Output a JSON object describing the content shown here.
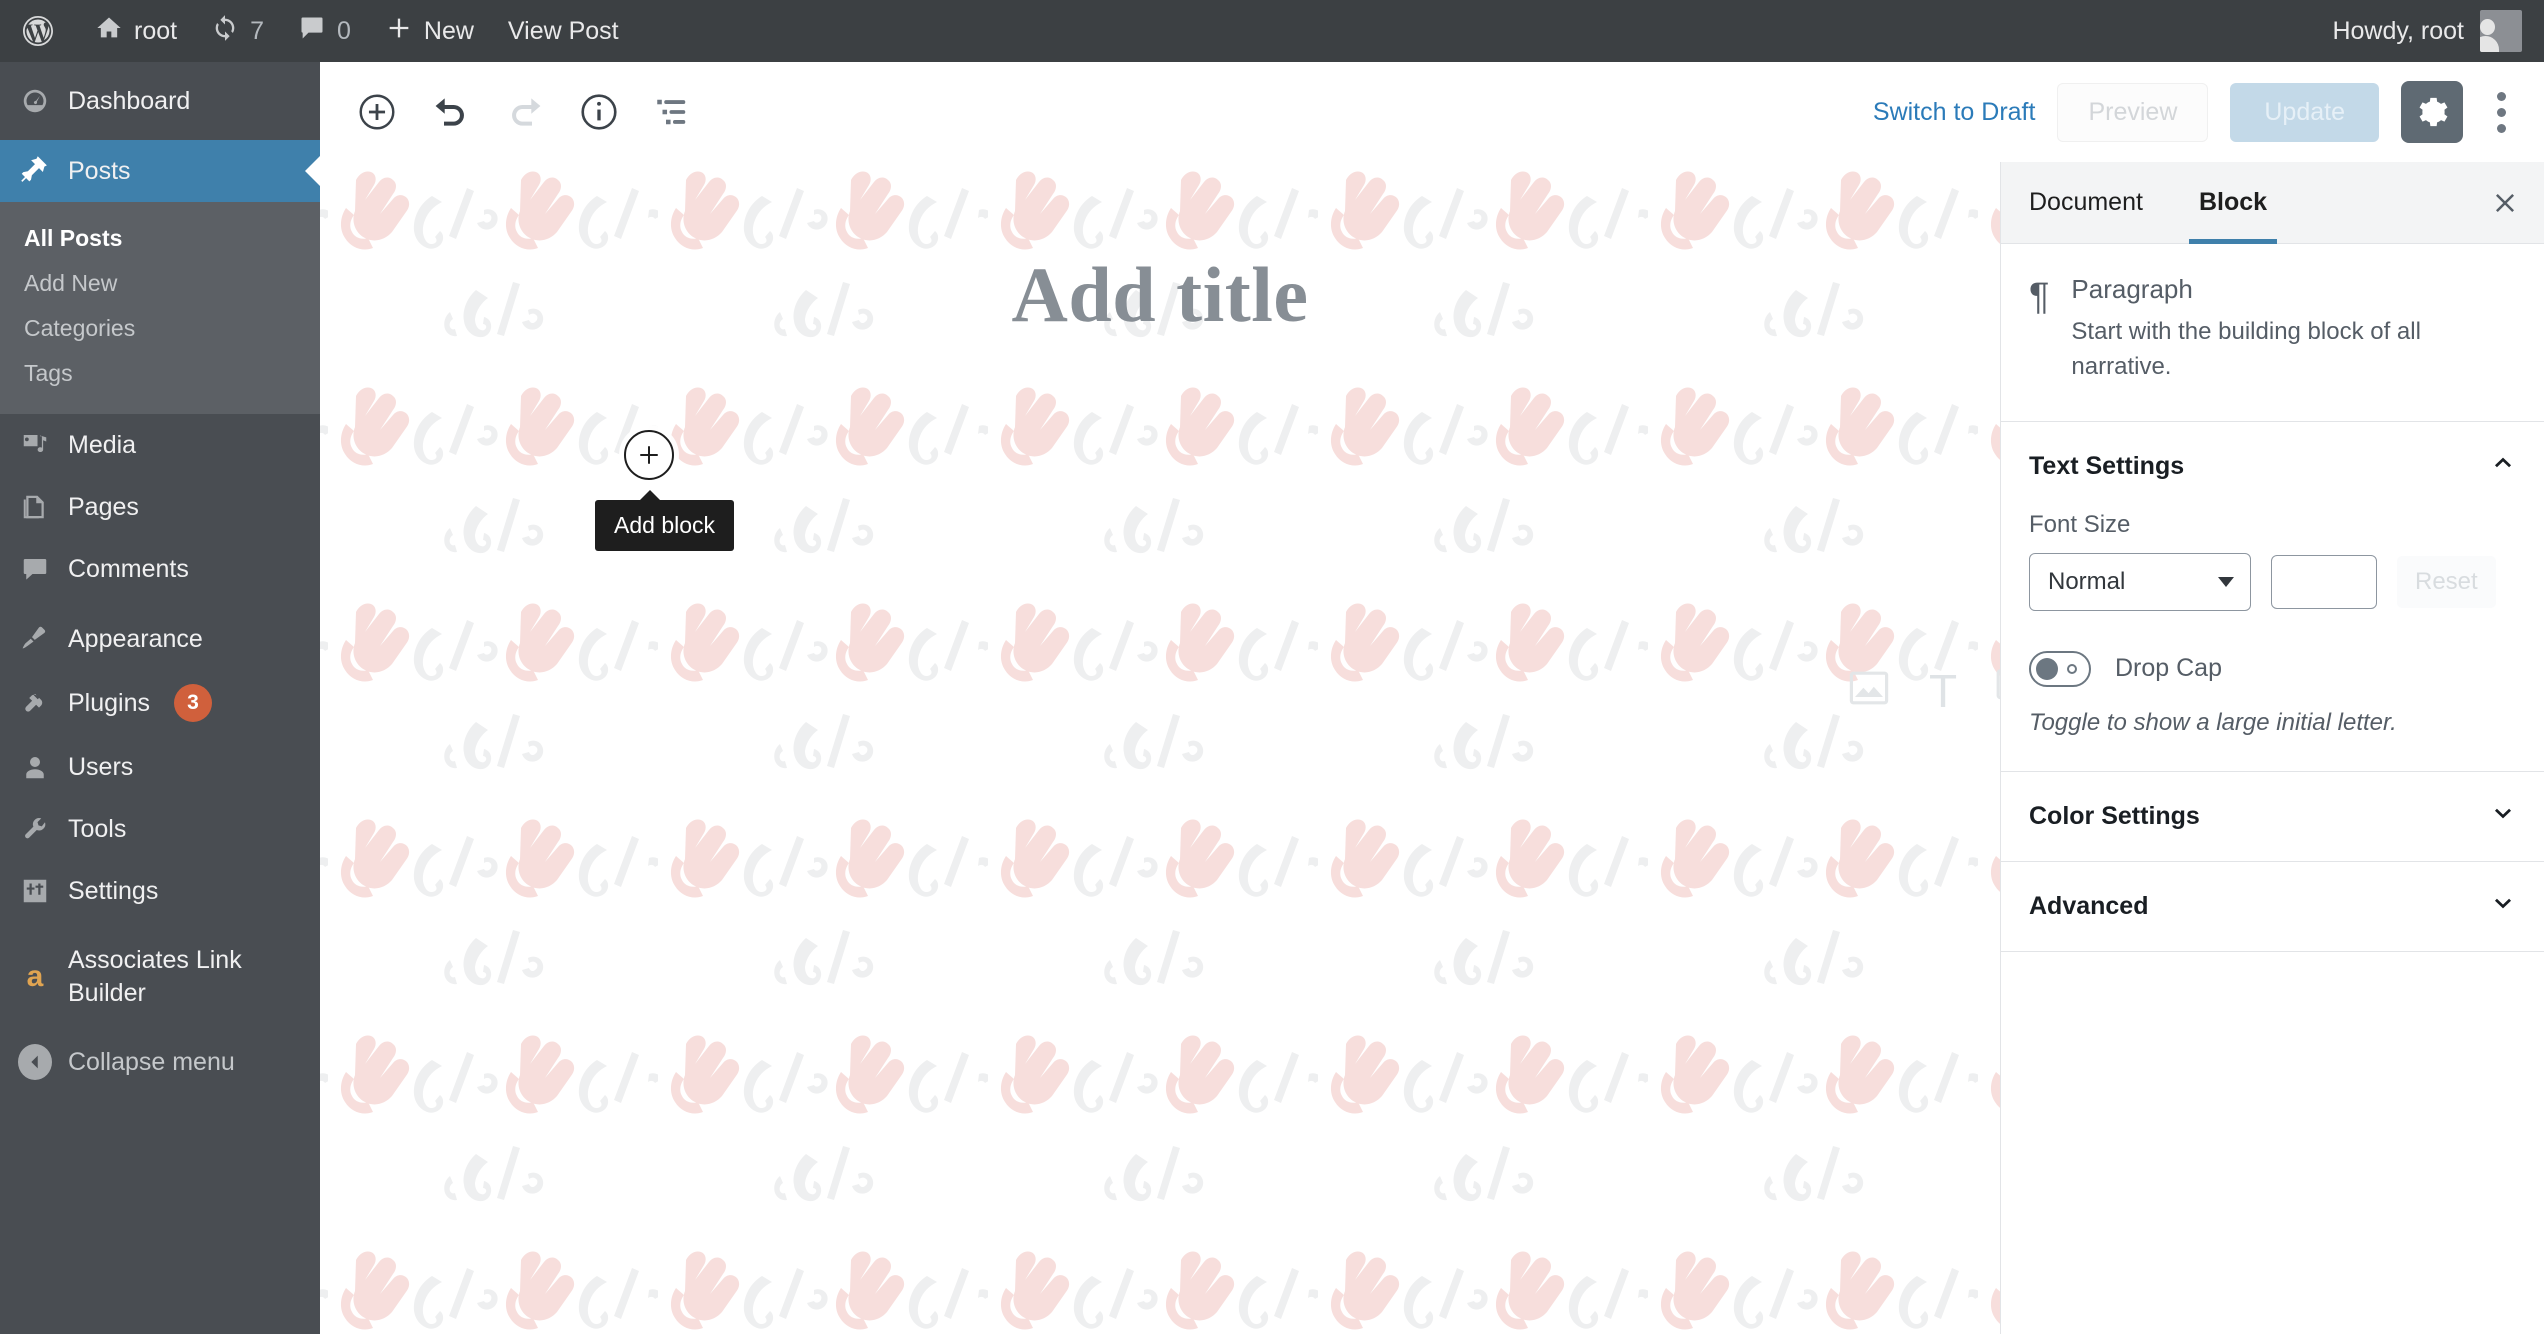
{
  "adminbar": {
    "logo_icon": "wordpress-logo-icon",
    "site_name": "root",
    "updates_count": "7",
    "comments_count": "0",
    "new_label": "New",
    "view_post_label": "View Post",
    "howdy": "Howdy, root"
  },
  "sidebar": {
    "items": [
      {
        "label": "Dashboard",
        "icon": "dashboard-icon",
        "active": false
      },
      {
        "label": "Posts",
        "icon": "pin-icon",
        "active": true
      },
      {
        "label": "Media",
        "icon": "media-icon",
        "active": false
      },
      {
        "label": "Pages",
        "icon": "pages-icon",
        "active": false
      },
      {
        "label": "Comments",
        "icon": "comments-icon",
        "active": false
      },
      {
        "label": "Appearance",
        "icon": "appearance-brush-icon",
        "active": false
      },
      {
        "label": "Plugins",
        "icon": "plugins-plug-icon",
        "active": false,
        "badge": "3"
      },
      {
        "label": "Users",
        "icon": "users-icon",
        "active": false
      },
      {
        "label": "Tools",
        "icon": "tools-wrench-icon",
        "active": false
      },
      {
        "label": "Settings",
        "icon": "settings-sliders-icon",
        "active": false
      },
      {
        "label": "Associates Link Builder",
        "icon": "amazon-a-icon",
        "active": false
      }
    ],
    "submenu": [
      {
        "label": "All Posts",
        "current": true
      },
      {
        "label": "Add New",
        "current": false
      },
      {
        "label": "Categories",
        "current": false
      },
      {
        "label": "Tags",
        "current": false
      }
    ],
    "collapse_label": "Collapse menu"
  },
  "toolbar": {
    "add_block_icon": "plus-circle-icon",
    "undo_icon": "undo-icon",
    "redo_icon": "redo-icon",
    "info_icon": "info-circle-icon",
    "block_navigation_icon": "content-structure-icon",
    "switch_to_draft_label": "Switch to Draft",
    "preview_label": "Preview",
    "update_label": "Update",
    "settings_gear_icon": "gear-icon",
    "more_menu_icon": "kebab-menu-icon"
  },
  "editor": {
    "title_placeholder": "Add title",
    "add_block_tooltip": "Add block",
    "quick_inserts": [
      {
        "icon": "image-icon"
      },
      {
        "icon": "text-icon",
        "glyph": "T"
      },
      {
        "icon": "gallery-icon"
      }
    ]
  },
  "settings_panel": {
    "tabs": [
      {
        "label": "Document",
        "active": false
      },
      {
        "label": "Block",
        "active": true
      }
    ],
    "close_icon": "close-icon",
    "block": {
      "icon": "paragraph-pilcrow-icon",
      "glyph": "¶",
      "name": "Paragraph",
      "description": "Start with the building block of all narrative."
    },
    "text_settings": {
      "title": "Text Settings",
      "expanded": true,
      "font_size_label": "Font Size",
      "font_size_value": "Normal",
      "font_size_custom_value": "",
      "reset_label": "Reset",
      "drop_cap_label": "Drop Cap",
      "drop_cap_on": false,
      "drop_cap_help": "Toggle to show a large initial letter."
    },
    "color_settings": {
      "title": "Color Settings",
      "expanded": false
    },
    "advanced": {
      "title": "Advanced",
      "expanded": false
    }
  },
  "colors": {
    "adminbar_bg": "#3c4043",
    "sidebar_bg": "#494d52",
    "submenu_bg": "#5c6065",
    "accent_blue": "#3f80ab",
    "link_blue": "#2b7bb9",
    "badge_orange": "#d0603c",
    "watermark_pink": "#f7dedc",
    "watermark_gray": "#eeeff0"
  }
}
